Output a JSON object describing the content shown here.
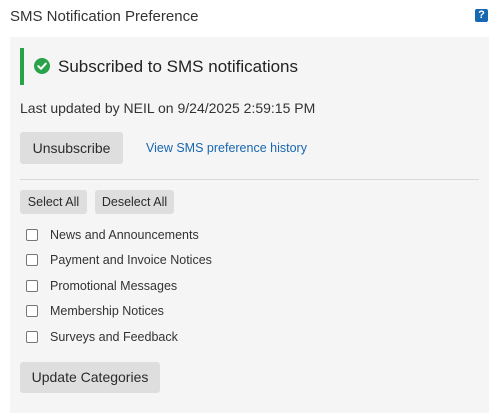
{
  "header": {
    "title": "SMS Notification Preference",
    "help_label": "?"
  },
  "status": {
    "title": "Subscribed to SMS notifications",
    "updated_text": "Last updated by NEIL on 9/24/2025 2:59:15 PM",
    "accent_color": "#2aa24a",
    "icon": "check-circle-icon"
  },
  "actions": {
    "unsubscribe_label": "Unsubscribe",
    "history_link": "View SMS preference history",
    "select_all_label": "Select All",
    "deselect_all_label": "Deselect All",
    "update_label": "Update Categories"
  },
  "categories": [
    {
      "label": "News and Announcements",
      "checked": false
    },
    {
      "label": "Payment and Invoice Notices",
      "checked": false
    },
    {
      "label": "Promotional Messages",
      "checked": false
    },
    {
      "label": "Membership Notices",
      "checked": false
    },
    {
      "label": "Surveys and Feedback",
      "checked": false
    }
  ],
  "colors": {
    "link": "#1767b1",
    "help_icon_bg": "#1767b1",
    "panel_bg": "#f5f5f5",
    "button_bg": "#dedede"
  }
}
